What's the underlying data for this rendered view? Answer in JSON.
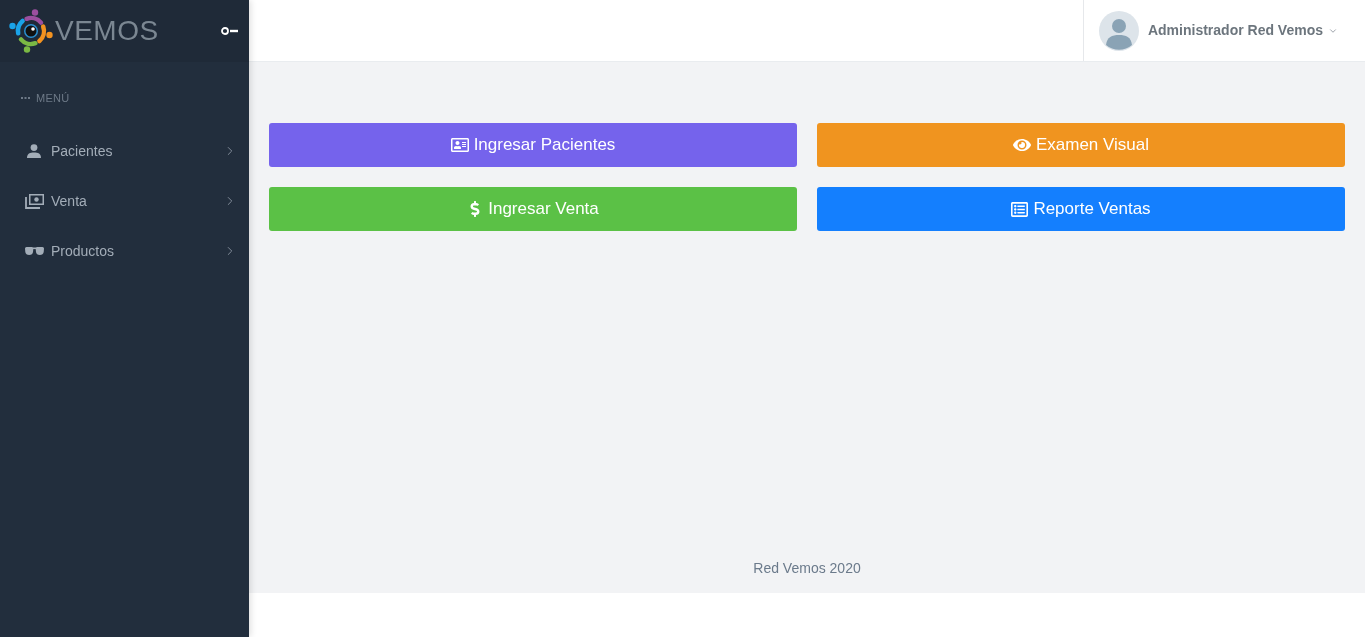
{
  "sidebar": {
    "brand": "VEMOS",
    "toggle": {
      "on": false
    },
    "section_label": "MENÚ",
    "items": [
      {
        "label": "Pacientes",
        "expanded": false
      },
      {
        "label": "Venta",
        "expanded": false
      },
      {
        "label": "Productos",
        "expanded": false
      }
    ]
  },
  "header": {
    "user_name": "Administrador Red Vemos"
  },
  "actions": [
    {
      "label": "Ingresar Pacientes",
      "color": "#7563ec"
    },
    {
      "label": "Examen Visual",
      "color": "#f0941f"
    },
    {
      "label": "Ingresar Venta",
      "color": "#5bc146"
    },
    {
      "label": "Reporte Ventas",
      "color": "#147ffe"
    }
  ],
  "footer": {
    "text": "Red Vemos 2020"
  }
}
